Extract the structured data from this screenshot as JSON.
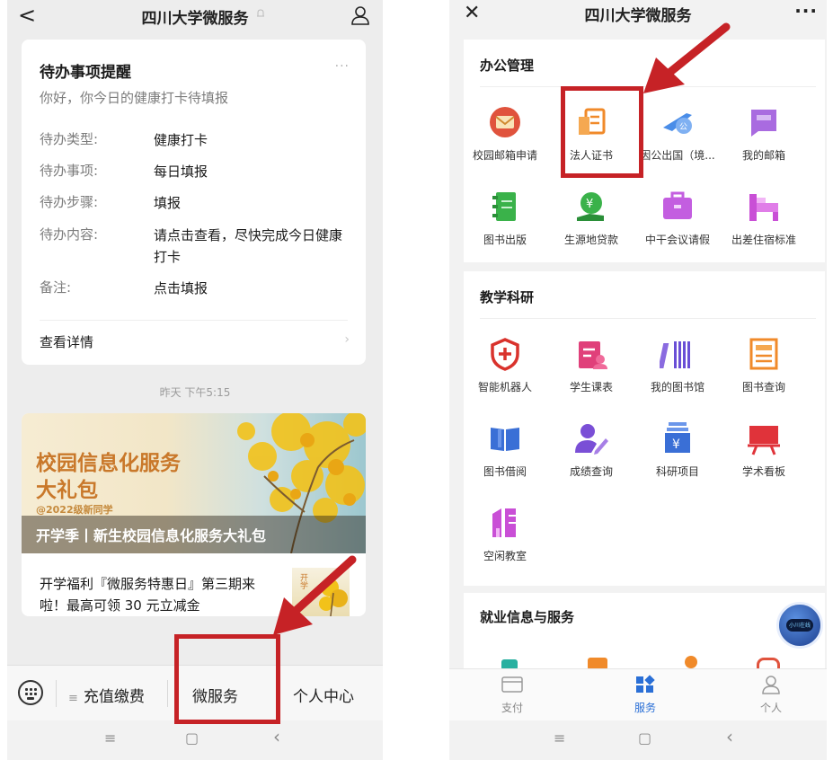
{
  "left": {
    "topbar": {
      "title": "四川大学微服务"
    },
    "todo": {
      "title": "待办事项提醒",
      "greeting": "你好，你今日的健康打卡待填报",
      "rows": [
        {
          "key": "待办类型:",
          "value": "健康打卡"
        },
        {
          "key": "待办事项:",
          "value": "每日填报"
        },
        {
          "key": "待办步骤:",
          "value": "填报"
        },
        {
          "key": "待办内容:",
          "value": "请点击查看，尽快完成今日健康打卡"
        },
        {
          "key": "备注:",
          "value": "点击填报"
        }
      ],
      "detail_link": "查看详情"
    },
    "timestamp": "昨天 下午5:15",
    "article": {
      "banner_line1": "校园信息化服务",
      "banner_line2": "大礼包",
      "banner_sub": "@2022级新同学",
      "banner_caption": "开学季丨新生校园信息化服务大礼包",
      "title": "开学福利『微服务特惠日』第三期来啦！最高可领 30 元立减金",
      "thumb_text": "开学"
    },
    "menubar": {
      "item1": "充值缴费",
      "item2": "微服务",
      "item3": "个人中心"
    },
    "navbar": {
      "menu": "≡",
      "home": "▢",
      "back": "‹"
    }
  },
  "right": {
    "topbar": {
      "title": "四川大学微服务",
      "more": "···"
    },
    "office": {
      "title": "办公管理",
      "items": [
        {
          "label": "校园邮箱申请",
          "icon": "mail-envelope-icon",
          "color": "#e0533d"
        },
        {
          "label": "法人证书",
          "icon": "certificate-icon",
          "color": "#f08a2a"
        },
        {
          "label": "因公出国（境...",
          "icon": "airplane-icon",
          "color": "#4a8de8"
        },
        {
          "label": "我的邮箱",
          "icon": "chat-box-icon",
          "color": "#9a5ad6"
        },
        {
          "label": "图书出版",
          "icon": "notebook-icon",
          "color": "#3ab24a"
        },
        {
          "label": "生源地贷款",
          "icon": "loan-hand-icon",
          "color": "#3ab24a"
        },
        {
          "label": "中干会议请假",
          "icon": "briefcase-icon",
          "color": "#b84fd6"
        },
        {
          "label": "出差住宿标准",
          "icon": "bed-icon",
          "color": "#c94fd6"
        }
      ]
    },
    "teaching": {
      "title": "教学科研",
      "items": [
        {
          "label": "智能机器人",
          "icon": "shield-plus-icon",
          "color": "#d9322c"
        },
        {
          "label": "学生课表",
          "icon": "calendar-person-icon",
          "color": "#e0407a"
        },
        {
          "label": "我的图书馆",
          "icon": "bookshelf-icon",
          "color": "#6a4fd6"
        },
        {
          "label": "图书查询",
          "icon": "newspaper-icon",
          "color": "#f08a2a"
        },
        {
          "label": "图书借阅",
          "icon": "open-book-icon",
          "color": "#3a6fd6"
        },
        {
          "label": "成绩查询",
          "icon": "user-edit-icon",
          "color": "#7a4fd6"
        },
        {
          "label": "科研项目",
          "icon": "money-box-icon",
          "color": "#3a6fd6"
        },
        {
          "label": "学术看板",
          "icon": "billboard-icon",
          "color": "#e0333a"
        },
        {
          "label": "空闲教室",
          "icon": "building-icon",
          "color": "#c94fd6"
        }
      ]
    },
    "job": {
      "title": "就业信息与服务",
      "bot_text": "小川在线"
    },
    "tabbar": {
      "pay": "支付",
      "service": "服务",
      "me": "个人"
    },
    "navbar": {
      "menu": "≡",
      "home": "▢",
      "back": "‹"
    }
  },
  "annotation_color": "#c62226"
}
